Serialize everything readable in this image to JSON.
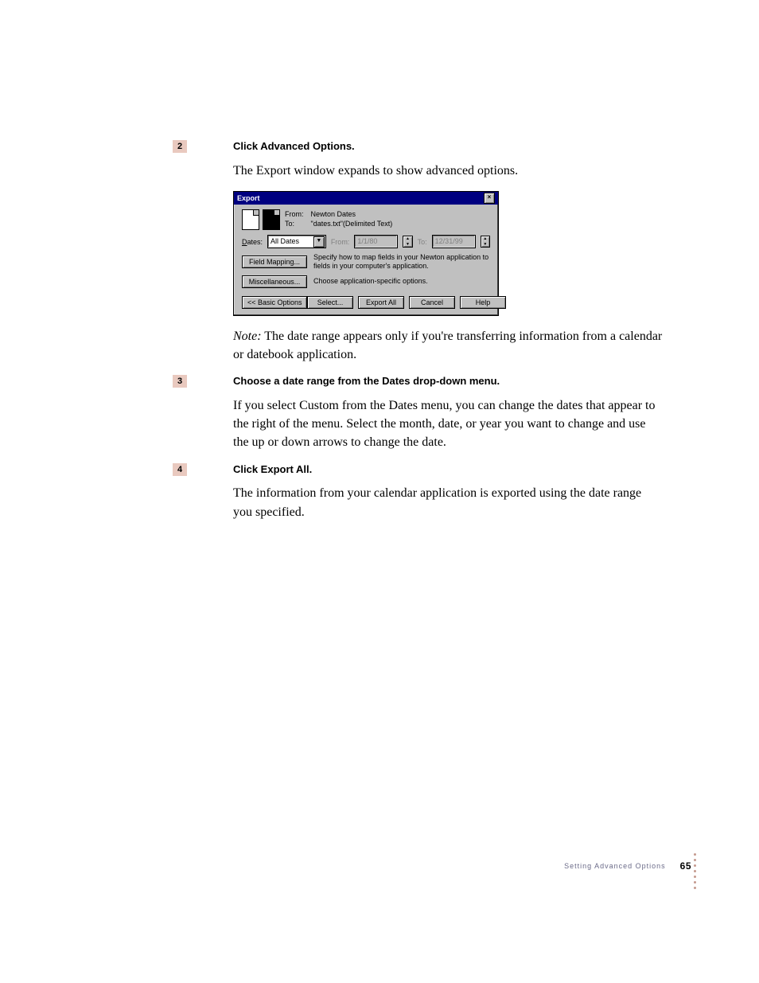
{
  "steps": {
    "s2": {
      "num": "2",
      "title": "Click Advanced Options.",
      "body": "The Export window expands to show advanced options."
    },
    "note2": {
      "prefix": "Note:",
      "text": "  The date range appears only if you're transferring information from a calendar or datebook application."
    },
    "s3": {
      "num": "3",
      "title": "Choose a date range from the Dates drop-down menu.",
      "body": "If you select Custom from the Dates menu, you can change the dates that appear to the right of the menu. Select the month, date, or year you want to change and use the up or down arrows to change the date."
    },
    "s4": {
      "num": "4",
      "title": "Click Export All.",
      "body": "The information from your calendar application is exported using the date range you specified."
    }
  },
  "dialog": {
    "title": "Export",
    "from_label": "From:",
    "from_value": "Newton Dates",
    "to_label": "To:",
    "to_value": "\"dates.txt\"(Delimited Text)",
    "dates_label": "Dates:",
    "dates_value": "All Dates",
    "from_date_label": "From:",
    "from_date_value": "1/1/80",
    "to_date_label": "To:",
    "to_date_value": "12/31/99",
    "field_mapping_btn": "Field Mapping...",
    "field_mapping_desc": "Specify how to map fields in your Newton application to fields in your computer's application.",
    "misc_btn": "Miscellaneous...",
    "misc_desc": "Choose application-specific options.",
    "basic_btn": "<< Basic Options",
    "select_btn": "Select...",
    "exportall_btn": "Export All",
    "cancel_btn": "Cancel",
    "help_btn": "Help"
  },
  "footer": {
    "section": "Setting Advanced Options",
    "page": "65"
  }
}
